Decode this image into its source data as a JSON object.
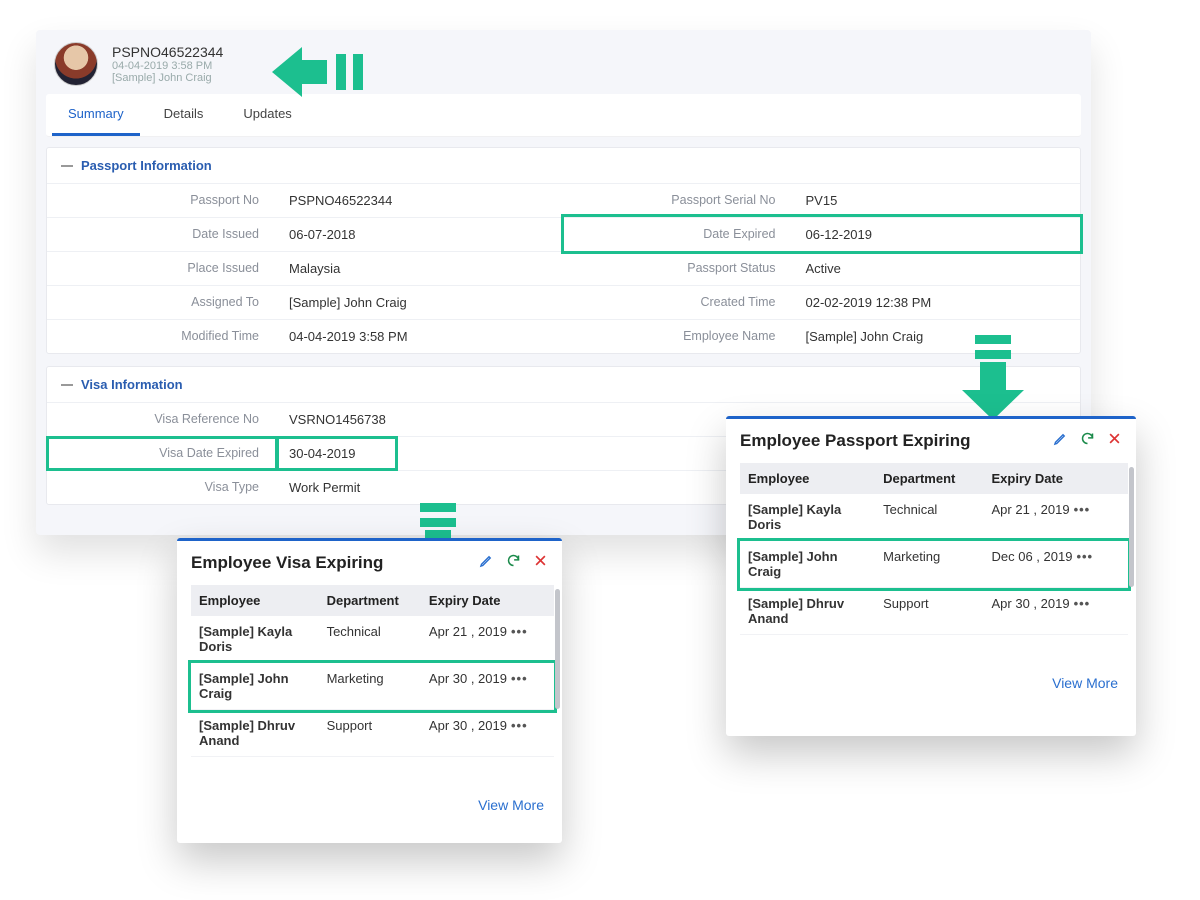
{
  "header": {
    "title": "PSPNO46522344",
    "timestamp": "04-04-2019 3:58 PM",
    "owner": "[Sample] John Craig"
  },
  "tabs": {
    "t0": "Summary",
    "t1": "Details",
    "t2": "Updates"
  },
  "passport": {
    "section_title": "Passport Information",
    "passport_no_label": "Passport No",
    "passport_no": "PSPNO46522344",
    "serial_label": "Passport Serial No",
    "serial": "PV15",
    "date_issued_label": "Date Issued",
    "date_issued": "06-07-2018",
    "date_expired_label": "Date Expired",
    "date_expired": "06-12-2019",
    "place_issued_label": "Place Issued",
    "place_issued": "Malaysia",
    "status_label": "Passport Status",
    "status": "Active",
    "assigned_to_label": "Assigned To",
    "assigned_to": "[Sample] John Craig",
    "created_time_label": "Created Time",
    "created_time": "02-02-2019 12:38 PM",
    "modified_time_label": "Modified Time",
    "modified_time": "04-04-2019 3:58 PM",
    "employee_name_label": "Employee Name",
    "employee_name": "[Sample] John Craig"
  },
  "visa": {
    "section_title": "Visa Information",
    "ref_label": "Visa Reference No",
    "ref": "VSRNO1456738",
    "expired_label": "Visa Date Expired",
    "expired": "30-04-2019",
    "type_label": "Visa Type",
    "type": "Work Permit"
  },
  "widget_visa": {
    "title": "Employee Visa Expiring",
    "cols": {
      "c0": "Employee",
      "c1": "Department",
      "c2": "Expiry Date"
    },
    "rows": [
      {
        "emp": "[Sample] Kayla Doris",
        "dept": "Technical",
        "date": "Apr 21 , 2019"
      },
      {
        "emp": "[Sample] John Craig",
        "dept": "Marketing",
        "date": "Apr 30 , 2019"
      },
      {
        "emp": "[Sample] Dhruv Anand",
        "dept": "Support",
        "date": "Apr 30 , 2019"
      }
    ],
    "view_more": "View More"
  },
  "widget_passport": {
    "title": "Employee Passport Expiring",
    "cols": {
      "c0": "Employee",
      "c1": "Department",
      "c2": "Expiry Date"
    },
    "rows": [
      {
        "emp": "[Sample] Kayla Doris",
        "dept": "Technical",
        "date": "Apr 21 , 2019"
      },
      {
        "emp": "[Sample] John Craig",
        "dept": "Marketing",
        "date": "Dec 06 , 2019"
      },
      {
        "emp": "[Sample] Dhruv Anand",
        "dept": "Support",
        "date": "Apr 30 , 2019"
      }
    ],
    "view_more": "View More"
  }
}
